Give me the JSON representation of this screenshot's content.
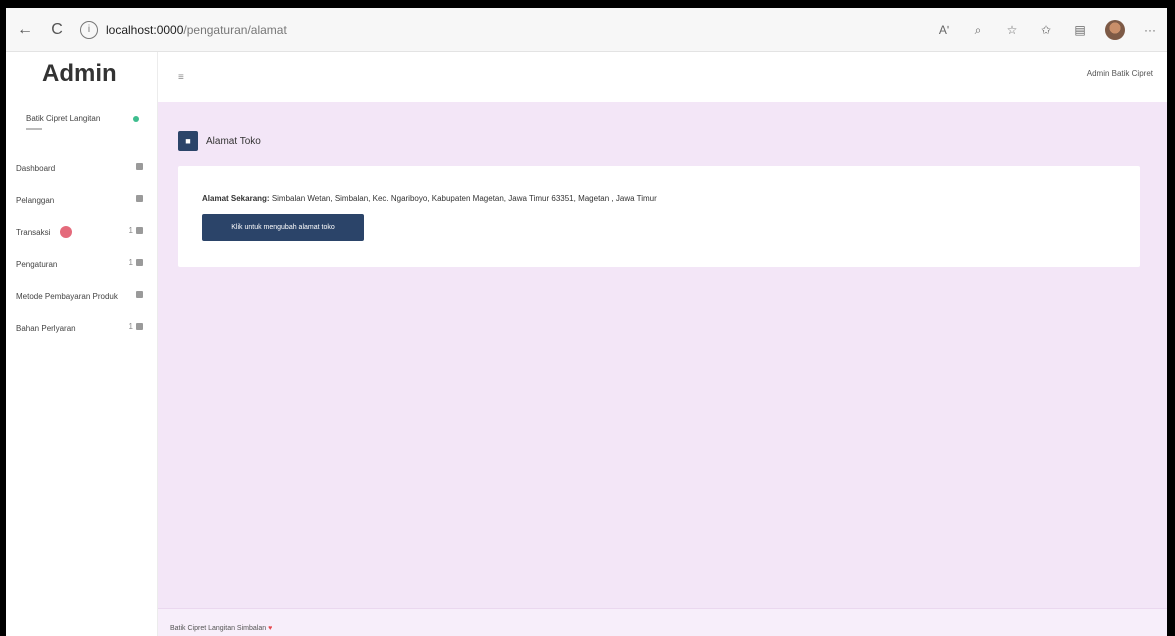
{
  "browser": {
    "url_host": "localhost:0000",
    "url_path": "/pengaturan/alamat",
    "back_glyph": "←",
    "reload_glyph": "C",
    "info_glyph": "i",
    "icons": [
      "read-aloud-icon",
      "zoom-icon",
      "star-icon",
      "favorites-icon",
      "collections-icon",
      "profile-icon",
      "more-icon"
    ],
    "icon_glyphs": [
      "Aʹ",
      "⌕",
      "☆",
      "✩",
      "▤",
      "",
      "···"
    ]
  },
  "sidebar": {
    "brand": "Admin",
    "store_name": "Batik Cipret Langitan",
    "items": [
      {
        "label": "Dashboard",
        "count": ""
      },
      {
        "label": "Pelanggan",
        "count": ""
      },
      {
        "label": "Transaksi",
        "count": "1"
      },
      {
        "label": "Pengaturan",
        "count": "1"
      },
      {
        "label": "Metode Pembayaran Produk",
        "count": ""
      },
      {
        "label": "Bahan Perlyaran",
        "count": "1"
      }
    ]
  },
  "header": {
    "hamburger_glyph": "≡",
    "user": "Admin Batik Cipret"
  },
  "main": {
    "title": "Alamat Toko",
    "address_label": "Alamat Sekarang:",
    "address_value": " Simbalan Wetan, Simbalan, Kec. Ngariboyo, Kabupaten Magetan, Jawa Timur 63351, Magetan , Jawa Timur",
    "button_label": "Klik untuk mengubah alamat toko"
  },
  "footer": {
    "text": "Batik Cipret Langitan Simbalan",
    "heart": "♥"
  },
  "colors": {
    "accent": "#2b4469",
    "background": "#f3e6f7",
    "badge": "#e46a7b",
    "online": "#3ebd8e"
  }
}
